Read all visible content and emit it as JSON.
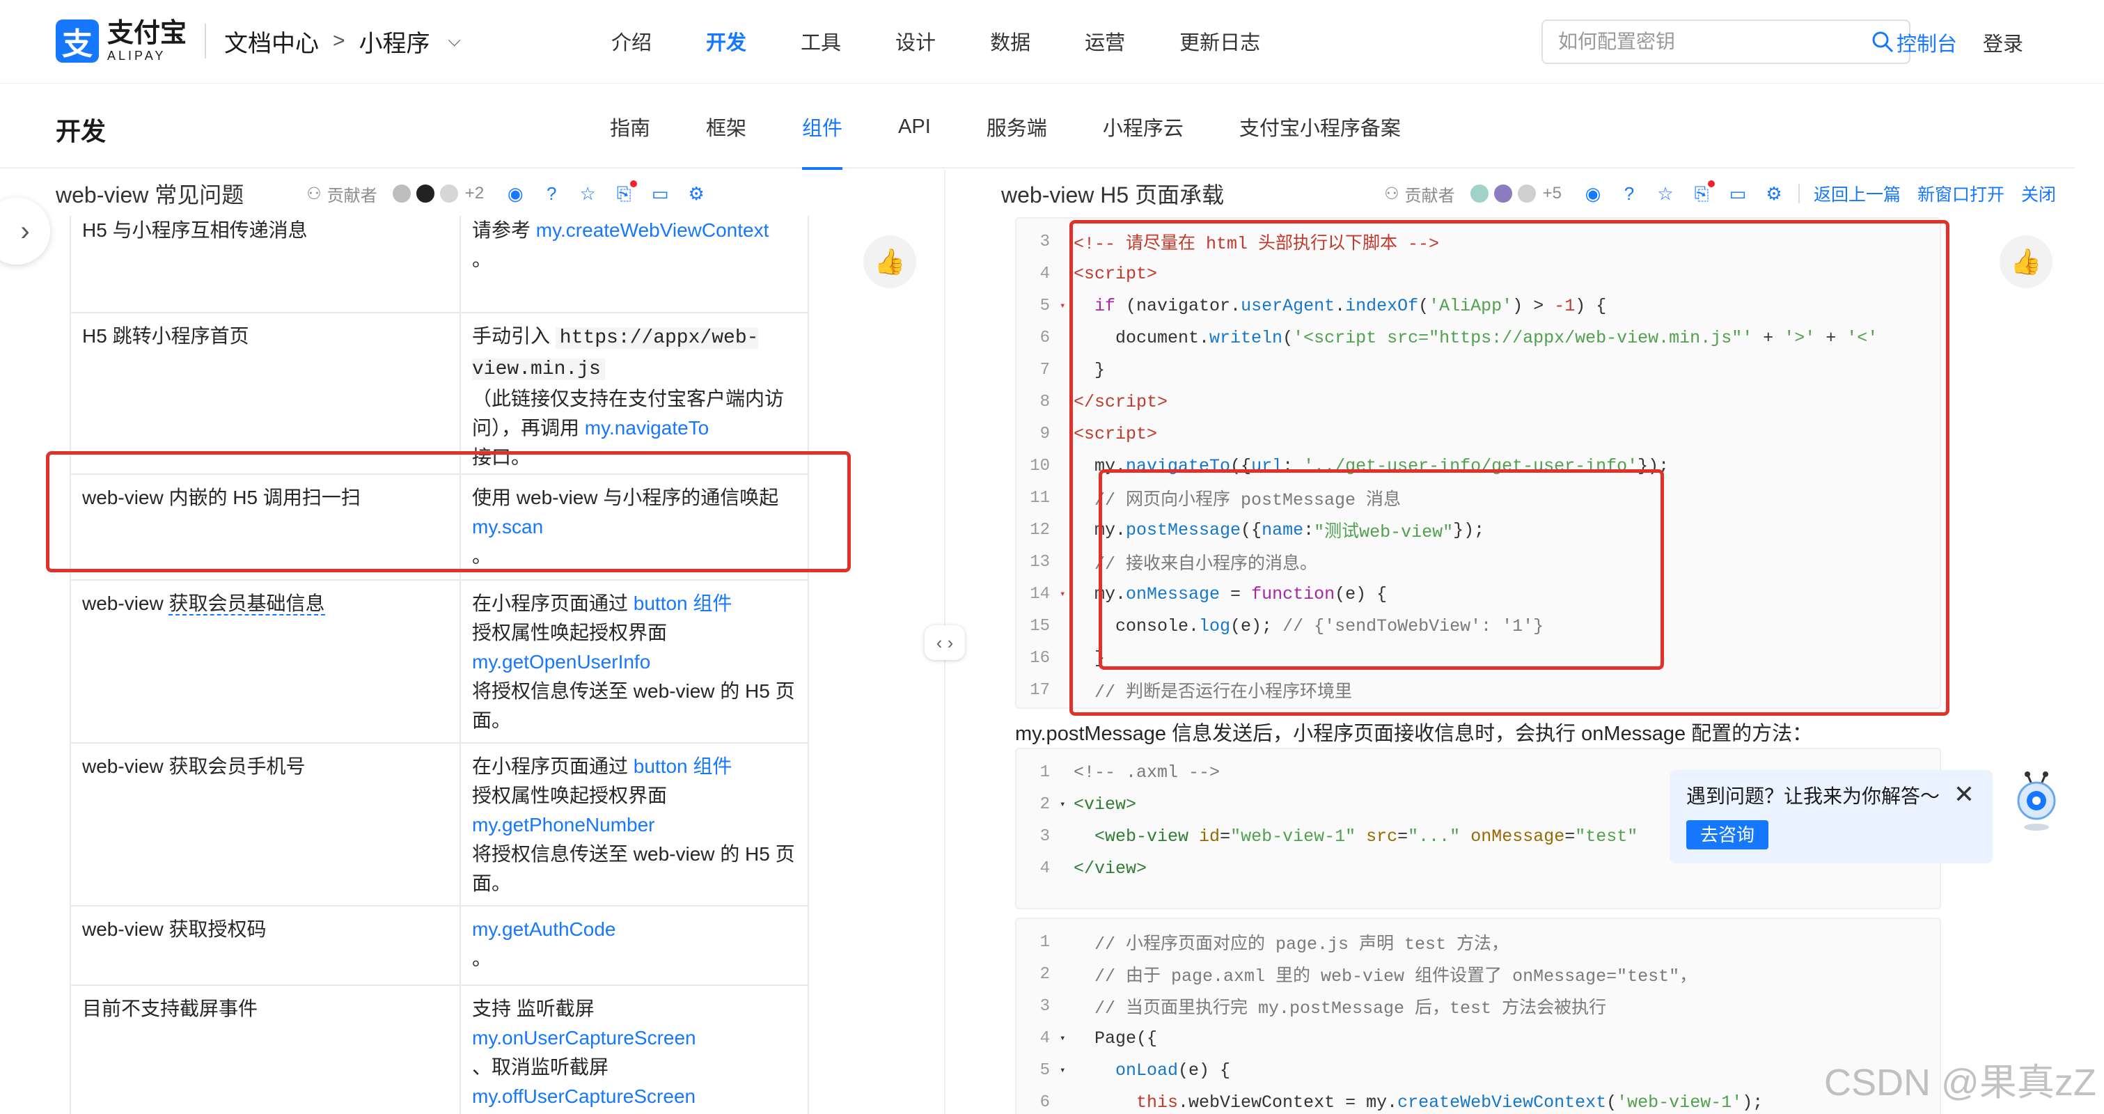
{
  "topnav": {
    "logo_cn": "支付宝",
    "logo_en": "ALIPAY",
    "doc_center": "文档中心",
    "crumb_sep": ">",
    "crumb_current": "小程序",
    "menu": [
      "介绍",
      "开发",
      "工具",
      "设计",
      "数据",
      "运营",
      "更新日志"
    ],
    "active_menu": "开发",
    "search_placeholder": "如何配置密钥",
    "console": "控制台",
    "login": "登录"
  },
  "subnav": {
    "title": "开发",
    "tabs": [
      "指南",
      "框架",
      "组件",
      "API",
      "服务端",
      "小程序云",
      "支付宝小程序备案"
    ],
    "active_tab": "组件"
  },
  "left_pane": {
    "title": "web-view 常见问题",
    "contributors_label": "贡献者",
    "contributors_more": "+2",
    "rows": [
      {
        "q": "H5 与小程序互相传递消息",
        "a_pre": "请参考 ",
        "a_link": "my.createWebViewContext",
        "a_post": "。"
      },
      {
        "q": "H5 跳转小程序首页",
        "a_pre": "手动引入 ",
        "a_code": "https://appx/web-view.min.js",
        "a_mid": "（此链接仅支持在支付宝客户端内访问），再调用 ",
        "a_link": "my.navigateTo",
        "a_post": " 接口。"
      },
      {
        "q": "web-view 内嵌的 H5 调用扫一扫",
        "a_pre": "使用 web-view 与小程序的通信唤起 ",
        "a_link": "my.scan",
        "a_post": "。"
      },
      {
        "q_pre": "web-view ",
        "q_dashed": "获取会员基础信息",
        "a_pre": "在小程序页面通过 ",
        "a_link": "button 组件",
        "a_mid": " 授权属性唤起授权界面 ",
        "a_link2": "my.getOpenUserInfo",
        "a_post": " 将授权信息传送至 web-view 的 H5 页面。"
      },
      {
        "q": "web-view 获取会员手机号",
        "a_pre": "在小程序页面通过 ",
        "a_link": "button 组件",
        "a_mid": " 授权属性唤起授权界面 ",
        "a_link2": "my.getPhoneNumber",
        "a_post": " 将授权信息传送至 web-view 的 H5 页面。"
      },
      {
        "q": "web-view 获取授权码",
        "a_link": "my.getAuthCode",
        "a_post": "。"
      },
      {
        "q": "目前不支持截屏事件",
        "a_pre": "支持 监听截屏 ",
        "a_link": "my.onUserCaptureScreen",
        "a_mid": "、取消监听截屏 ",
        "a_link2": "my.offUserCaptureScreen"
      }
    ]
  },
  "right_pane": {
    "title": "web-view H5 页面承载",
    "contributors_label": "贡献者",
    "contributors_more": "+5",
    "links": [
      "返回上一篇",
      "新窗口打开",
      "关闭"
    ],
    "code1_lines": [
      "3",
      "4",
      "5",
      "6",
      "7",
      "8",
      "9",
      "10",
      "11",
      "12",
      "13",
      "14",
      "15",
      "16",
      "17"
    ],
    "desc": "my.postMessage 信息发送后，小程序页面接收信息时，会执行 onMessage 配置的方法：",
    "code2_lines": [
      "1",
      "2",
      "3",
      "4"
    ],
    "code3_lines": [
      "1",
      "2",
      "3",
      "4",
      "5",
      "6"
    ]
  },
  "help": {
    "text": "遇到问题？让我来为你解答～",
    "button": "去咨询"
  },
  "watermark": "CSDN @果真zZ",
  "colors": {
    "accent": "#1677ff",
    "highlight_box": "#e0312b"
  }
}
